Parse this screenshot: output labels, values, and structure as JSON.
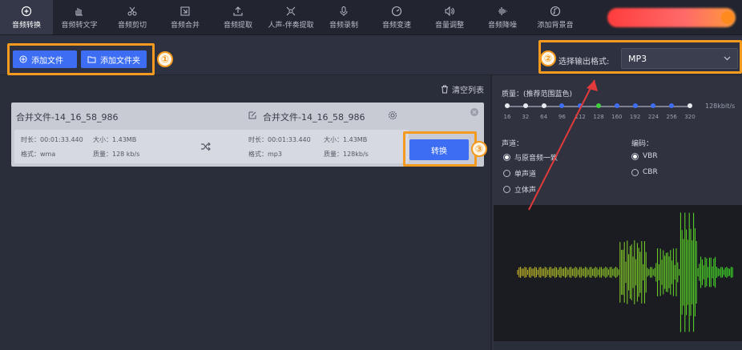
{
  "toolbar": {
    "items": [
      {
        "label": "音频转换",
        "icon": "convert-icon",
        "active": true
      },
      {
        "label": "音频转文字",
        "icon": "hand-text-icon"
      },
      {
        "label": "音频剪切",
        "icon": "scissors-icon"
      },
      {
        "label": "音频合并",
        "icon": "merge-icon"
      },
      {
        "label": "音频提取",
        "icon": "upload-icon"
      },
      {
        "label": "人声-伴奏提取",
        "icon": "voice-icon"
      },
      {
        "label": "音频录制",
        "icon": "mic-icon"
      },
      {
        "label": "音频变速",
        "icon": "speed-icon"
      },
      {
        "label": "音量调整",
        "icon": "volume-icon"
      },
      {
        "label": "音频降噪",
        "icon": "denoise-icon"
      },
      {
        "label": "添加背景音",
        "icon": "music-icon"
      }
    ]
  },
  "subbar": {
    "add_file": "添加文件",
    "add_folder": "添加文件夹",
    "marker1": "①",
    "marker2": "②",
    "format_label": "选择输出格式:",
    "format_value": "MP3"
  },
  "list": {
    "clear_label": "清空列表",
    "item": {
      "source_name": "合并文件-14_16_58_986",
      "target_name": "合并文件-14_16_58_986",
      "src_duration": "时长：00:01:33.440",
      "src_size": "大小：1.43MB",
      "src_format": "格式：wma",
      "src_quality": "质量：128 kb/s",
      "dst_duration": "时长：00:01:33.440",
      "dst_size": "大小：1.43MB",
      "dst_format": "格式：mp3",
      "dst_quality": "质量：128kb/s",
      "convert_label": "转换",
      "marker3": "③"
    }
  },
  "settings": {
    "quality_label": "质量：(推荐范围蓝色)",
    "ticks": [
      "16",
      "32",
      "64",
      "96",
      "112",
      "128",
      "160",
      "192",
      "224",
      "256",
      "320"
    ],
    "selected_tick": "128",
    "unit": "128kbit/s",
    "channel_label": "声道：",
    "channels": [
      {
        "label": "与原音频一致",
        "checked": true
      },
      {
        "label": "单声道",
        "checked": false
      },
      {
        "label": "立体声",
        "checked": false
      }
    ],
    "encoding_label": "编码：",
    "encodings": [
      {
        "label": "VBR",
        "checked": true
      },
      {
        "label": "CBR",
        "checked": false
      }
    ]
  },
  "colors": {
    "accent": "#3d6df2",
    "highlight": "#f39a1f",
    "arrow": "#e23a3a"
  }
}
